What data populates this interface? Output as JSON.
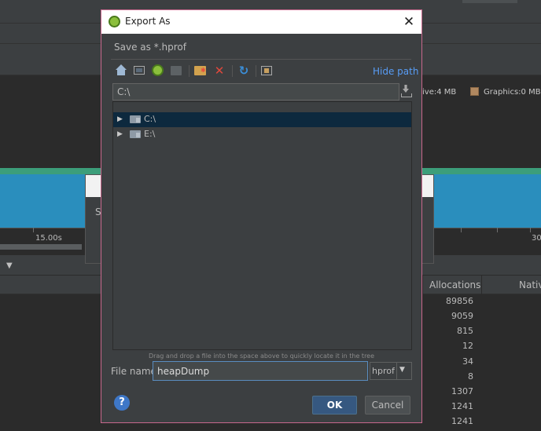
{
  "dialog": {
    "title": "Export As",
    "save_label": "Save as *.hprof",
    "hide_path_label": "Hide path",
    "path_value": "C:\\",
    "tree": [
      {
        "label": "C:\\",
        "selected": true
      },
      {
        "label": "E:\\",
        "selected": false
      }
    ],
    "hint": "Drag and drop a file into the space above to quickly locate it in the tree",
    "file_name_label": "File name:",
    "file_name_value": "heapDump",
    "extension_selected": "hprof",
    "ok_label": "OK",
    "cancel_label": "Cancel",
    "help_label": "?",
    "close_label": "✕"
  },
  "toolbar_icons": [
    "home-icon",
    "desktop-icon",
    "project-icon",
    "module-icon",
    "new-folder-icon",
    "delete-icon",
    "refresh-icon",
    "show-hidden-icon"
  ],
  "background": {
    "legend": {
      "native": "ive:4 MB",
      "graphics": "Graphics:0 MB"
    },
    "axis_labels": [
      "15.00s",
      "30"
    ],
    "behind_dialog_text": "Sa",
    "table_headers": [
      "Allocations",
      "Nativ"
    ],
    "allocations": [
      "89856",
      "9059",
      "815",
      "12",
      "34",
      "8",
      "1307",
      "1241",
      "1241"
    ]
  },
  "colors": {
    "accent_blue": "#589df6",
    "ok_button": "#365880",
    "dialog_border": "#c8688d",
    "delete_red": "#e0483c",
    "graph_blue": "#2a8ebd",
    "graph_green": "#3c9e7a"
  }
}
